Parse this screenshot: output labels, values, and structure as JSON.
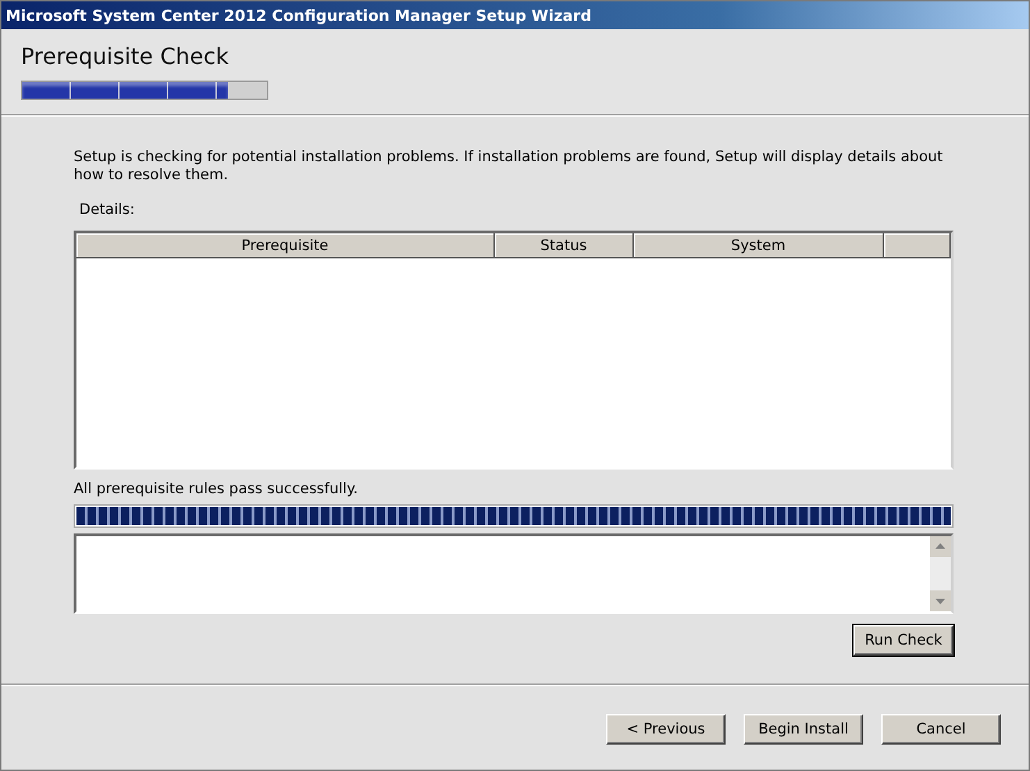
{
  "window": {
    "title": "Microsoft System Center 2012 Configuration Manager Setup Wizard"
  },
  "header": {
    "title": "Prerequisite Check",
    "progress": {
      "level": 0.84
    }
  },
  "intro": "Setup is checking for potential installation problems. If installation problems are found, Setup will display details about how to resolve them.",
  "details": {
    "label": "Details:",
    "columns": [
      "Prerequisite",
      "Status",
      "System"
    ]
  },
  "result": {
    "text": "All prerequisite rules pass successfully.",
    "progress": {
      "level": 1
    }
  },
  "run_check": "Run Check",
  "buttons": [
    "< Previous",
    "Begin Install",
    "Cancel"
  ]
}
